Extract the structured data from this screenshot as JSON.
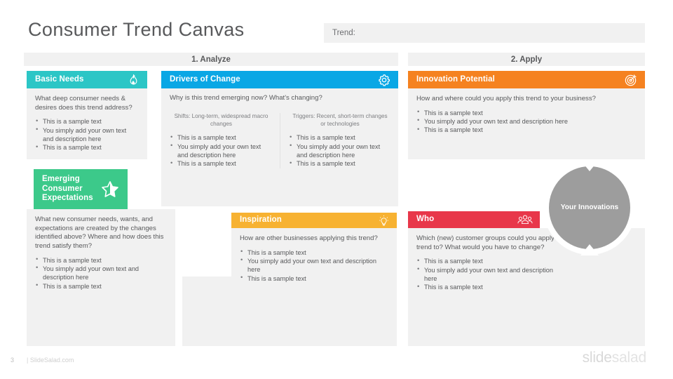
{
  "slide": {
    "title": "Consumer Trend Canvas",
    "page_number": "3",
    "footer_site": "| SlideSalad.com",
    "logo_a": "slide",
    "logo_b": "salad"
  },
  "trend": {
    "label": "Trend:",
    "value": "",
    "placeholder": "Trend:"
  },
  "sections": {
    "analyze": "1. Analyze",
    "apply": "2. Apply"
  },
  "colors": {
    "basic_needs": "#2cc6c6",
    "drivers": "#0aa7e5",
    "emerging": "#3cc98a",
    "inspiration": "#f7b232",
    "innovation": "#f58220",
    "who": "#e8374a",
    "circle": "#9d9d9d",
    "panel_bg": "#f1f1f1",
    "text": "#58595b"
  },
  "cards": {
    "basic_needs": {
      "title": "Basic Needs",
      "icon": "flame-icon",
      "question": "What deep consumer needs & desires does this trend address?",
      "bullets": [
        "This is a sample text",
        "You simply add your own text and description here",
        "This is a sample text"
      ]
    },
    "drivers": {
      "title": "Drivers of Change",
      "icon": "gear-icon",
      "question": "Why is this trend emerging now? What's changing?",
      "columns": [
        {
          "subhead": "Shifts: Long-term, widespread macro changes",
          "bullets": [
            "This is a sample text",
            "You simply add your own text and description here",
            "This is a sample text"
          ]
        },
        {
          "subhead": "Triggers: Recent, short-term changes or technologies",
          "bullets": [
            "This is a sample text",
            "You simply add your own text and description here",
            "This is a sample text"
          ]
        }
      ]
    },
    "emerging": {
      "title": "Emerging Consumer Expectations",
      "icon": "star-icon",
      "question": "What new consumer needs, wants, and expectations are created by the changes identified above? Where and how does this trend satisfy them?",
      "bullets": [
        "This is a sample text",
        "You simply add your own text and description here",
        "This is a sample text"
      ]
    },
    "inspiration": {
      "title": "Inspiration",
      "icon": "lightbulb-icon",
      "question": "How are other businesses applying this trend?",
      "bullets": [
        "This is a sample text",
        "You simply add your own text and description here",
        "This is a sample text"
      ]
    },
    "innovation": {
      "title": "Innovation Potential",
      "icon": "target-icon",
      "question": "How and where could you apply this trend to your business?",
      "bullets": [
        "This is a sample text",
        "You simply add your own text and description here",
        "This is a sample text"
      ]
    },
    "who": {
      "title": "Who",
      "icon": "people-icon",
      "question": "Which (new) customer groups could you apply this trend to? What would you have to change?",
      "bullets": [
        "This is a sample text",
        "You simply add your own text and description here",
        "This is a sample text"
      ]
    }
  },
  "center": {
    "label": "Your Innovations"
  }
}
